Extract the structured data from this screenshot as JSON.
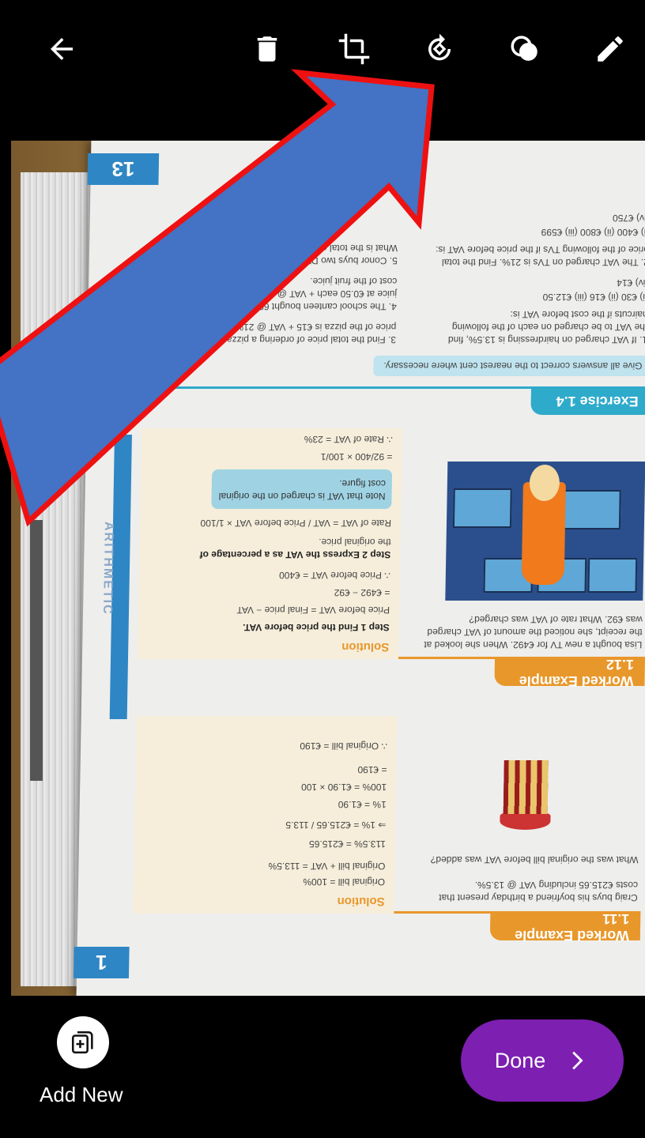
{
  "toolbar": {
    "back_icon": "arrow-left-icon",
    "delete_icon": "trash-icon",
    "crop_icon": "crop-icon",
    "rotate_icon": "rotate-icon",
    "filter_icon": "filter-icon",
    "edit_icon": "pencil-icon"
  },
  "document": {
    "page_number_top": "13",
    "page_number_bottom": "1",
    "side_label": "ARITHMETIC",
    "exercise_title": "Exercise 1.4",
    "instruction": "Give all answers correct to the nearest cent where necessary.",
    "worked_example_12": "Worked Example 1.12",
    "worked_example_11": "Worked Example 1.11",
    "solution_label": "Solution",
    "note": "Note that VAT is charged on the original cost figure.",
    "we12_lines": [
      "Step 1  Find the price before VAT.",
      "Price before VAT = Final price − VAT",
      "= €492 − €92",
      "∴ Price before VAT = €400",
      "Step 2  Express the VAT as a percentage of",
      "the original price.",
      "Rate of VAT = VAT / Price before VAT × 1/100",
      "= 92/400 × 100/1",
      "∴ Rate of VAT = 23%"
    ],
    "we12_question": [
      "Lisa bought a new TV for €492. When she looked at",
      "the receipt, she noticed the amount of VAT charged",
      "was €92. What rate of VAT was charged?"
    ],
    "we11_lines": [
      "Original bill = 100%",
      "Original bill + VAT = 113.5%",
      "113.5% = €215.65",
      "⇒ 1% = €215.65 / 113.5",
      "1% = €1.90",
      "100% = €1.90 × 100",
      "= €190",
      "∴ Original bill = €190"
    ],
    "we11_question": [
      "Craig buys his boyfriend a birthday present that",
      "costs €215.65 including VAT @ 13.5%.",
      "What was the original bill before VAT was added?"
    ],
    "exercise_items": [
      "1. If VAT charged on hairdressing is 13.5%, find",
      "the VAT to be charged on each of the following",
      "haircuts if the cost before VAT is:",
      "(i) €30    (ii) €16    (iii) €12.50",
      "(iv) €14",
      "2. The VAT charged on TVs is 21%. Find the total",
      "price of the following TVs if the price before VAT is:",
      "(i) €400   (ii) €800   (iii) €599",
      "(iv) €750",
      "3. Find the total price of ordering a pizza if the",
      "price of the pizza is €15 + VAT @ 21%.",
      "4. The school canteen bought 60 cartons of fruit",
      "juice at €0.50 each + VAT @ 21%. Find the total",
      "cost of the fruit juice.",
      "5. Conor buys two DVDs at €12 excluding VAT.",
      "What is the total cost?"
    ]
  },
  "bottom": {
    "add_new_label": "Add New",
    "done_label": "Done"
  }
}
